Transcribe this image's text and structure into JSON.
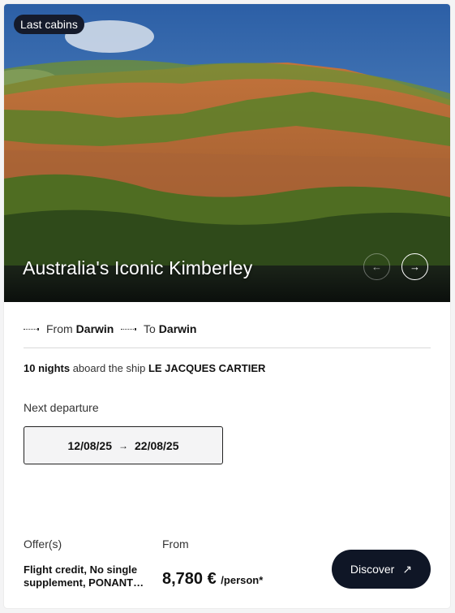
{
  "hero": {
    "badge": "Last cabins",
    "title": "Australia's Iconic Kimberley",
    "prev_icon": "arrow-left-icon",
    "next_icon": "arrow-right-icon"
  },
  "route": {
    "from_label": "From",
    "from_port": "Darwin",
    "to_label": "To",
    "to_port": "Darwin"
  },
  "voyage": {
    "nights": "10 nights",
    "aboard_text": "aboard the ship",
    "ship_name": "LE JACQUES CARTIER"
  },
  "departure": {
    "label": "Next departure",
    "start_date": "12/08/25",
    "end_date": "22/08/25"
  },
  "offers": {
    "label": "Offer(s)",
    "text": "Flight credit, No single supplement, PONANT…"
  },
  "pricing": {
    "label": "From",
    "amount": "8,780 €",
    "per": "/person*"
  },
  "cta": {
    "label": "Discover",
    "icon": "arrow-up-right-icon"
  },
  "colors": {
    "badge_bg": "#151b2c",
    "button_bg": "#0f1626",
    "date_box_bg": "#f4f4f5"
  }
}
